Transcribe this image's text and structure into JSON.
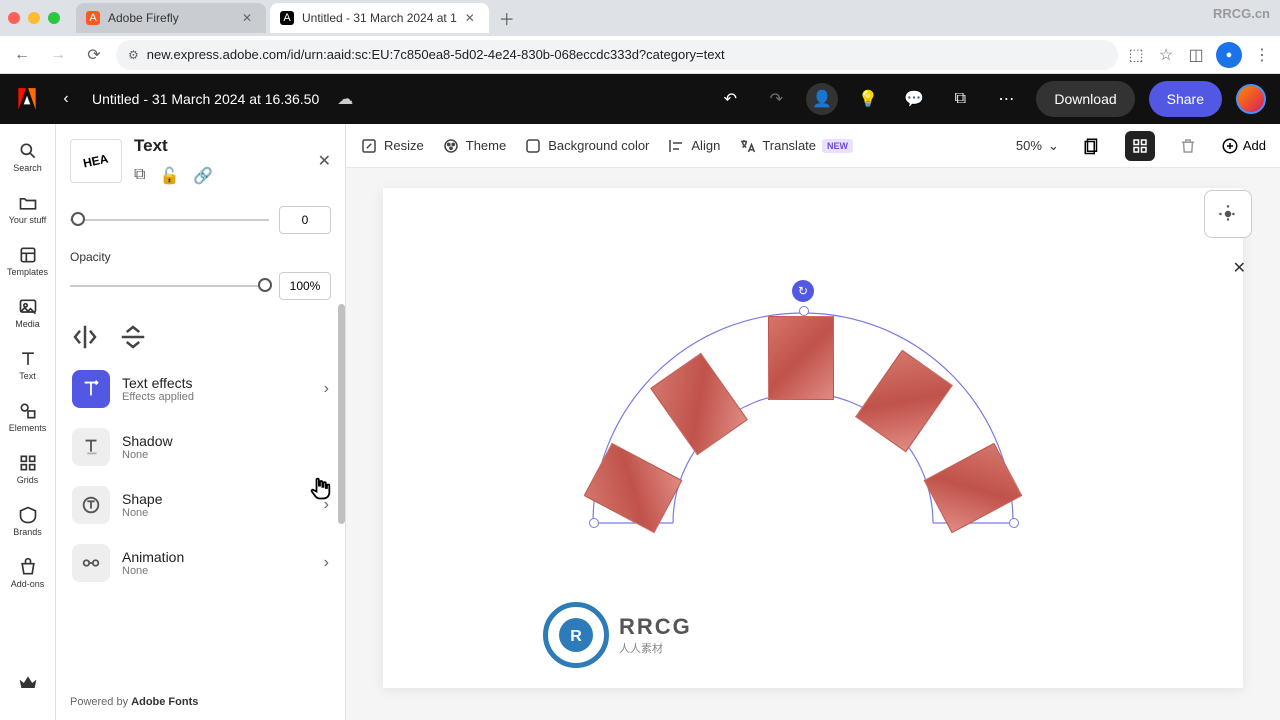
{
  "browser": {
    "tabs": [
      {
        "label": "Adobe Firefly",
        "icon": "A"
      },
      {
        "label": "Untitled - 31 March 2024 at 1",
        "icon": "A"
      }
    ],
    "url": "new.express.adobe.com/id/urn:aaid:sc:EU:7c850ea8-5d02-4e24-830b-068eccdc333d?category=text"
  },
  "app": {
    "doc_title": "Untitled - 31 March 2024 at 16.36.50",
    "download": "Download",
    "share": "Share"
  },
  "rail": {
    "items": [
      {
        "label": "Search"
      },
      {
        "label": "Your stuff"
      },
      {
        "label": "Templates"
      },
      {
        "label": "Media"
      },
      {
        "label": "Text"
      },
      {
        "label": "Elements"
      },
      {
        "label": "Grids"
      },
      {
        "label": "Brands"
      },
      {
        "label": "Add-ons"
      }
    ]
  },
  "panel": {
    "title": "Text",
    "slider1_value": "0",
    "opacity_label": "Opacity",
    "opacity_value": "100%",
    "effects": [
      {
        "name": "Text effects",
        "sub": "Effects applied",
        "active": true
      },
      {
        "name": "Shadow",
        "sub": "None",
        "active": false
      },
      {
        "name": "Shape",
        "sub": "None",
        "active": false
      },
      {
        "name": "Animation",
        "sub": "None",
        "active": false
      }
    ],
    "footer_prefix": "Powered by ",
    "footer_bold": "Adobe Fonts"
  },
  "toolbar": {
    "resize": "Resize",
    "theme": "Theme",
    "bgcolor": "Background color",
    "align": "Align",
    "translate": "Translate",
    "translate_badge": "NEW",
    "zoom": "50%",
    "add": "Add"
  },
  "watermark": {
    "main": "RRCG",
    "sub": "人人素材",
    "corner": "RRCG.cn"
  }
}
